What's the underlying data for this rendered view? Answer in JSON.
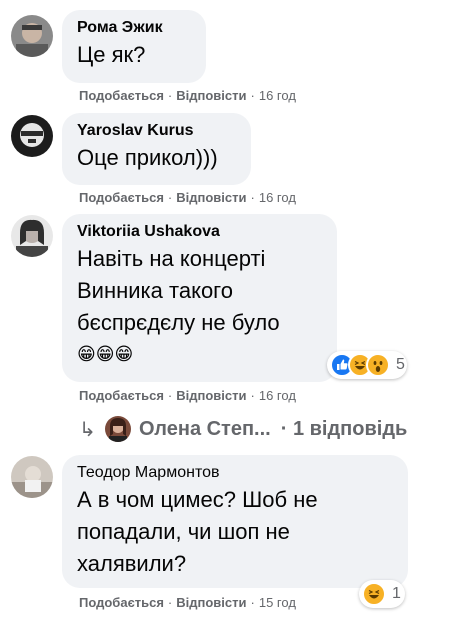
{
  "comments": [
    {
      "author": "Рома Эжик",
      "text": "Це як?",
      "actions": {
        "like": "Подобається",
        "reply": "Відповісти",
        "time": "16 год"
      }
    },
    {
      "author": "Yaroslav Kurus",
      "text": "Оце прикол)))",
      "actions": {
        "like": "Подобається",
        "reply": "Відповісти",
        "time": "16 год"
      }
    },
    {
      "author": "Viktoriia Ushakova",
      "text_lines": [
        "Навіть на концерті",
        "Винника такого",
        "бєспрєдєлу не було",
        "😁😁😁"
      ],
      "actions": {
        "like": "Подобається",
        "reply": "Відповісти",
        "time": "16 год"
      },
      "reactions": {
        "count": "5",
        "icons": [
          "like-icon",
          "haha-icon",
          "wow-icon"
        ]
      },
      "replies": {
        "preview_name": "Олена Степ...",
        "count_label": "· 1 відповідь"
      }
    },
    {
      "author": "Теодор Мармонтов",
      "text_lines": [
        "А в чом цимес? Шоб не",
        "попадали, чи шоп не",
        "халявили?"
      ],
      "actions": {
        "like": "Подобається",
        "reply": "Відповісти",
        "time": "15 год"
      },
      "reactions": {
        "count": "1",
        "icons": [
          "haha-icon"
        ]
      }
    }
  ],
  "colors": {
    "bubble": "#f0f2f5",
    "meta": "#65676b",
    "like": "#1877f2",
    "haha": "#f7b125"
  }
}
